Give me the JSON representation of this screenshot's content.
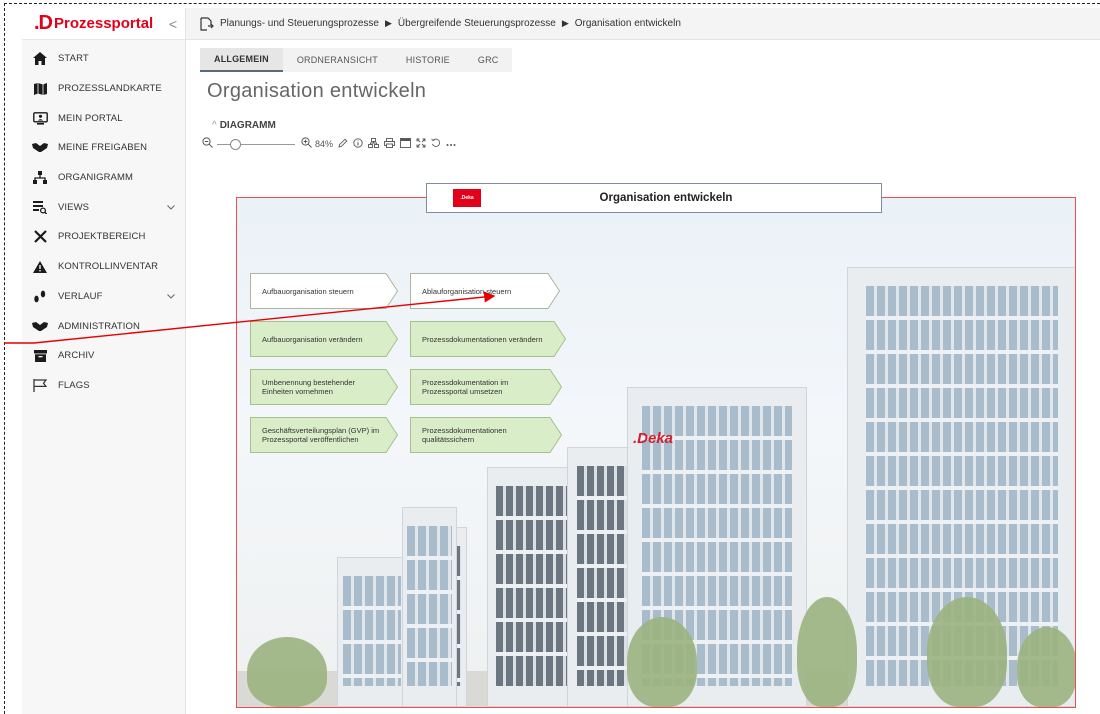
{
  "app": {
    "brand_mark": ".D",
    "brand_name": "Prozessportal",
    "collapse_glyph": "<"
  },
  "sidebar": {
    "items": [
      {
        "label": "START",
        "icon": "home-icon"
      },
      {
        "label": "PROZESSLANDKARTE",
        "icon": "map-icon"
      },
      {
        "label": "MEIN PORTAL",
        "icon": "portal-icon"
      },
      {
        "label": "MEINE FREIGABEN",
        "icon": "handshake-icon"
      },
      {
        "label": "ORGANIGRAMM",
        "icon": "org-chart-icon"
      },
      {
        "label": "VIEWS",
        "icon": "views-icon",
        "expandable": true
      },
      {
        "label": "PROJEKTBEREICH",
        "icon": "tools-icon"
      },
      {
        "label": "KONTROLLINVENTAR",
        "icon": "warning-icon"
      },
      {
        "label": "VERLAUF",
        "icon": "footsteps-icon",
        "expandable": true
      },
      {
        "label": "ADMINISTRATION",
        "icon": "handshake-icon"
      },
      {
        "label": "ARCHIV",
        "icon": "archive-icon"
      },
      {
        "label": "FLAGS",
        "icon": "flag-icon"
      }
    ]
  },
  "breadcrumb": {
    "items": [
      "Planungs- und Steuerungsprozesse",
      "Übergreifende Steuerungsprozesse",
      "Organisation entwickeln"
    ],
    "separator": "▶"
  },
  "tabs": [
    {
      "label": "ALLGEMEIN",
      "active": true
    },
    {
      "label": "ORDNERANSICHT",
      "active": false
    },
    {
      "label": "HISTORIE",
      "active": false
    },
    {
      "label": "GRC",
      "active": false
    }
  ],
  "page": {
    "title": "Organisation entwickeln",
    "section_label": "DIAGRAMM"
  },
  "toolbar": {
    "zoom_value": "84%",
    "zoom_level": 0.2,
    "icons": [
      "zoom-out-icon",
      "zoom-in-icon",
      "edit-icon",
      "info-icon",
      "hierarchy-icon",
      "print-icon",
      "window-icon",
      "fullscreen-icon",
      "reset-icon",
      "more-icon"
    ]
  },
  "diagram": {
    "title": "Organisation entwickeln",
    "logo_text": ".Deka",
    "building_sign": ".Deka",
    "steps": [
      {
        "label": "Aufbauorganisation steuern",
        "variant": "white"
      },
      {
        "label": "Ablauforganisation steuern",
        "variant": "white"
      },
      {
        "label": "Aufbauorganisation verändern",
        "variant": "green"
      },
      {
        "label": "Prozessdokumentationen verändern",
        "variant": "green"
      },
      {
        "label": "Umbenennung bestehender Einheiten vornehmen",
        "variant": "green"
      },
      {
        "label": "Prozessdokumentation im Prozessportal umsetzen",
        "variant": "green"
      },
      {
        "label": "Geschäftsverteilungsplan (GVP) im Prozessportal veröffentlichen",
        "variant": "green"
      },
      {
        "label": "Prozessdokumentationen qualitätssichern",
        "variant": "green"
      }
    ]
  },
  "colors": {
    "brand": "#e2001a",
    "step_green": "#d9edc8",
    "step_white": "#ffffff",
    "annotation_arrow": "#e60000"
  }
}
